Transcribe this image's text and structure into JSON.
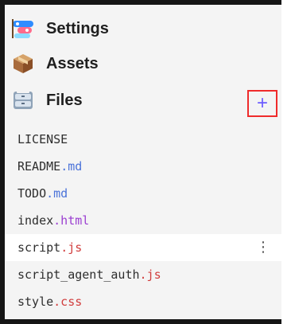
{
  "sections": {
    "settings": {
      "label": "Settings",
      "icon": "settings-fish-icon"
    },
    "assets": {
      "label": "Assets",
      "icon": "package-icon"
    },
    "files": {
      "label": "Files",
      "icon": "file-cabinet-icon",
      "add_label": "+"
    }
  },
  "files": [
    {
      "name": "LICENSE",
      "ext": "",
      "ext_color": "#2e2e2e"
    },
    {
      "name": "README",
      "ext": ".md",
      "ext_color": "#4b73d9"
    },
    {
      "name": "TODO",
      "ext": ".md",
      "ext_color": "#4b73d9"
    },
    {
      "name": "index",
      "ext": ".html",
      "ext_color": "#9b3fd1"
    },
    {
      "name": "script",
      "ext": ".js",
      "ext_color": "#d13d3d",
      "selected": true
    },
    {
      "name": "script_agent_auth",
      "ext": ".js",
      "ext_color": "#d13d3d"
    },
    {
      "name": "style",
      "ext": ".css",
      "ext_color": "#d13d3d"
    }
  ],
  "colors": {
    "accent": "#6b5cff",
    "highlight": "#ef2b2b"
  }
}
